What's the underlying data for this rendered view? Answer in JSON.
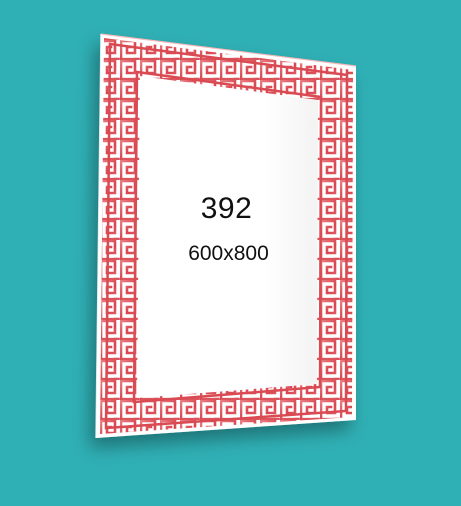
{
  "background_color": "#2fb0b5",
  "product": {
    "model_number": "392",
    "dimensions": "600x800",
    "border_pattern": "greek-key-meander",
    "border_color": "#d94a52",
    "mirror_fill": "#ffffff"
  }
}
